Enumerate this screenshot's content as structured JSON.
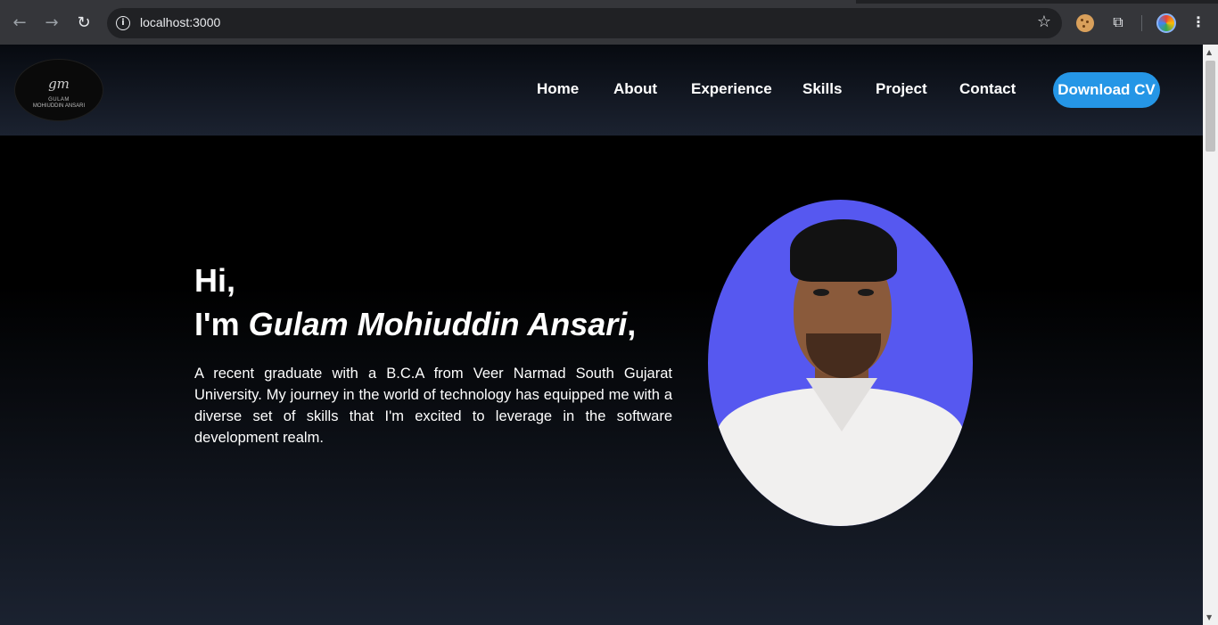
{
  "browser": {
    "url": "localhost:3000",
    "icons": {
      "back": "back-arrow-icon",
      "forward": "forward-arrow-icon",
      "reload": "reload-icon",
      "info": "info-icon",
      "bookmark": "star-icon",
      "extension_cookie": "cookie-icon",
      "extensions": "puzzle-icon",
      "profile": "profile-icon",
      "menu": "menu-icon"
    }
  },
  "header": {
    "logo": {
      "mark": "gm",
      "line1": "GULAM",
      "line2": "MOHIUDDIN ANSARI"
    },
    "nav": [
      {
        "label": "Home"
      },
      {
        "label": "About"
      },
      {
        "label": "Experience"
      },
      {
        "label": "Skills"
      },
      {
        "label": "Project"
      },
      {
        "label": "Contact"
      }
    ],
    "cta_label": "Download CV"
  },
  "hero": {
    "greeting": "Hi,",
    "intro_prefix": "I'm ",
    "name": "Gulam Mohiuddin Ansari",
    "intro_suffix": ",",
    "description": "A recent graduate with a B.C.A from Veer Narmad South Gujarat University. My journey in the world of technology has equipped me with a diverse set of skills that I'm excited to leverage in the software development realm."
  },
  "colors": {
    "accent": "#2596e6",
    "photo_background": "#5658f0"
  }
}
